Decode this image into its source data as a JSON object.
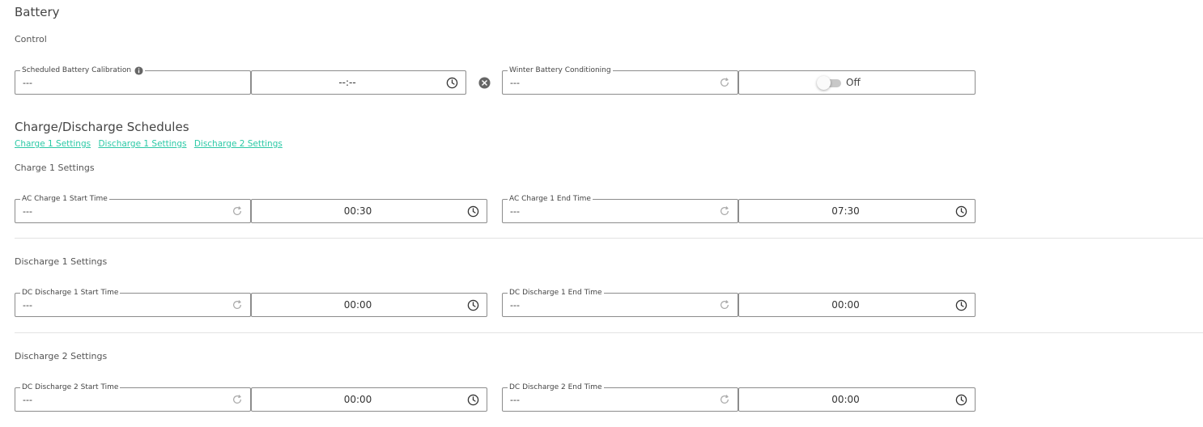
{
  "battery": {
    "title": "Battery",
    "control_label": "Control",
    "calibration": {
      "label": "Scheduled Battery Calibration",
      "value": "---",
      "time": "--:--"
    },
    "winter": {
      "label": "Winter Battery Conditioning",
      "value": "---",
      "toggle_state": "Off"
    }
  },
  "schedules": {
    "title": "Charge/Discharge Schedules",
    "links": [
      "Charge 1 Settings",
      "Discharge 1 Settings",
      "Discharge 2 Settings"
    ],
    "charge1": {
      "title": "Charge 1 Settings",
      "start": {
        "label": "AC Charge 1 Start Time",
        "value": "---",
        "time": "00:30"
      },
      "end": {
        "label": "AC Charge 1 End Time",
        "value": "---",
        "time": "07:30"
      }
    },
    "discharge1": {
      "title": "Discharge 1 Settings",
      "start": {
        "label": "DC Discharge 1 Start Time",
        "value": "---",
        "time": "00:00"
      },
      "end": {
        "label": "DC Discharge 1 End Time",
        "value": "---",
        "time": "00:00"
      }
    },
    "discharge2": {
      "title": "Discharge 2 Settings",
      "start": {
        "label": "DC Discharge 2 Start Time",
        "value": "---",
        "time": "00:00"
      },
      "end": {
        "label": "DC Discharge 2 End Time",
        "value": "---",
        "time": "00:00"
      }
    }
  },
  "colors": {
    "link": "#2cc9a6",
    "border": "#8c8c8c",
    "icon": "#555555"
  }
}
